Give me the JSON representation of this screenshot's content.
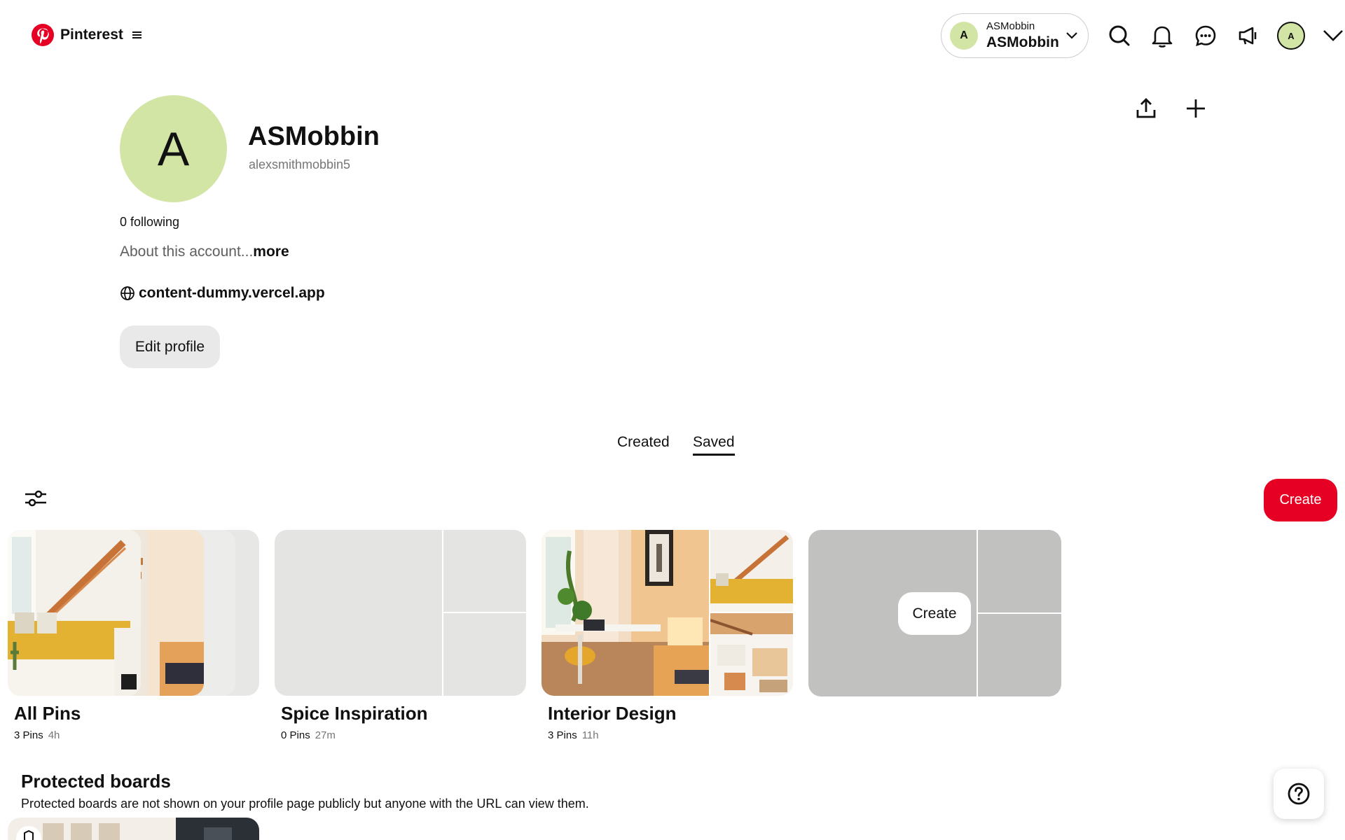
{
  "header": {
    "brand": "Pinterest",
    "account_switcher": {
      "initial": "A",
      "small_name": "ASMobbin",
      "big_name": "ASMobbin"
    },
    "avatar_initial": "A",
    "icons": [
      "search-icon",
      "bell-icon",
      "chat-icon",
      "megaphone-icon"
    ]
  },
  "profile": {
    "initial": "A",
    "name": "ASMobbin",
    "username": "alexsmithmobbin5",
    "following": "0 following",
    "about": "About this account...",
    "about_more": "more",
    "website": "content-dummy.vercel.app",
    "edit_label": "Edit profile"
  },
  "tabs": {
    "created": "Created",
    "saved": "Saved",
    "active": "Saved"
  },
  "toolbar": {
    "create_label": "Create"
  },
  "boards": [
    {
      "title": "All Pins",
      "pins": "3 Pins",
      "ago": "4h"
    },
    {
      "title": "Spice Inspiration",
      "pins": "0 Pins",
      "ago": "27m"
    },
    {
      "title": "Interior Design",
      "pins": "3 Pins",
      "ago": "11h"
    }
  ],
  "ghost_board": {
    "create_label": "Create"
  },
  "protected": {
    "title": "Protected boards",
    "description": "Protected boards are not shown on your profile page publicly but anyone with the URL can view them."
  },
  "colors": {
    "brand_red": "#e60023",
    "avatar_green": "#d2e5a4",
    "button_grey": "#e9e9e9",
    "muted_text": "#767676"
  }
}
